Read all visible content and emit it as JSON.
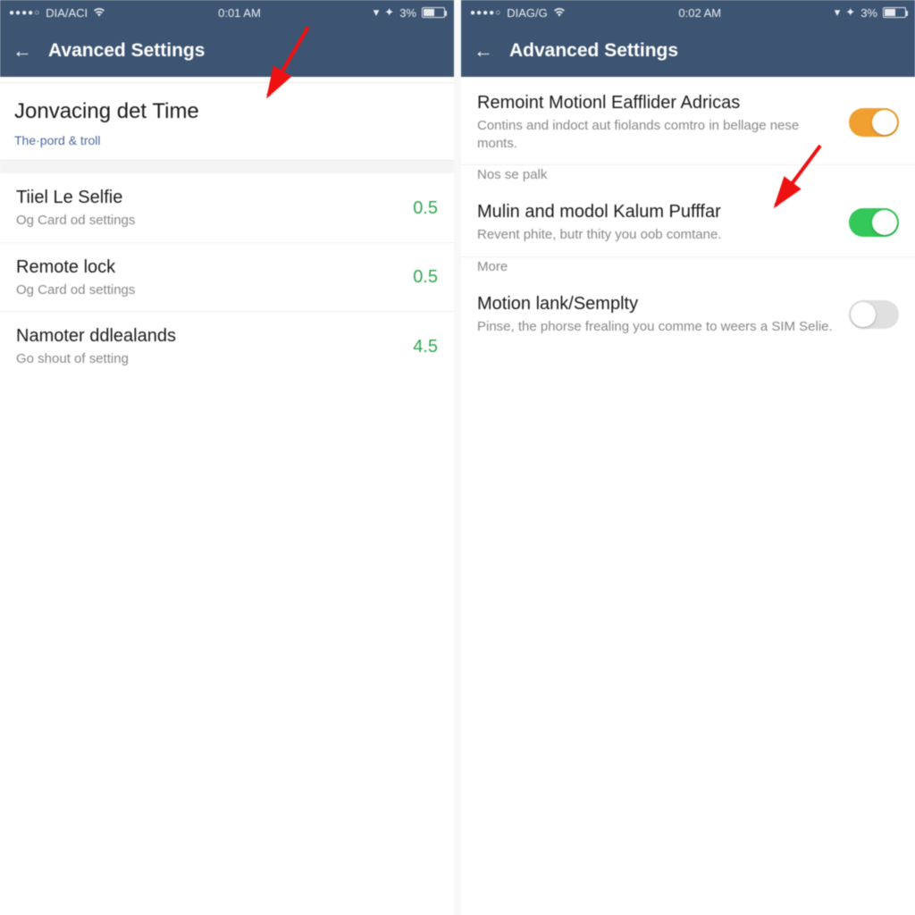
{
  "left": {
    "status": {
      "carrier": "DIA/ACI",
      "time": "0:01 AM",
      "battery": "3%"
    },
    "nav": {
      "title": "Avanced Settings"
    },
    "card": {
      "title": "Jonvacing det Time",
      "sub": "The·pord & troll"
    },
    "rows": [
      {
        "title": "Tiiel Le Selfie",
        "sub": "Og Card od settings",
        "value": "0.5"
      },
      {
        "title": "Remote lock",
        "sub": "Og Card od settings",
        "value": "0.5"
      },
      {
        "title": "Namoter ddlealands",
        "sub": "Go shout of setting",
        "value": "4.5"
      }
    ]
  },
  "right": {
    "status": {
      "carrier": "DIAG/G",
      "time": "0:02 AM",
      "battery": "3%"
    },
    "nav": {
      "title": "Advanced Settings"
    },
    "rows": [
      {
        "title": "Remoint Motionl Eafflider Adricas",
        "sub": "Contins and indoct aut fiolands comtro in bellage nese monts.",
        "toggle": "on-orange",
        "section": "Nos se palk"
      },
      {
        "title": "Mulin and modol Kalum Pufffar",
        "sub": "Revent phite, butr thity you oob comtane.",
        "toggle": "on-green",
        "section": "More"
      },
      {
        "title": "Motion lank/Semplty",
        "sub": "Pinse, the phorse frealing you comme to weers a SIM Selie.",
        "toggle": "off"
      }
    ]
  }
}
